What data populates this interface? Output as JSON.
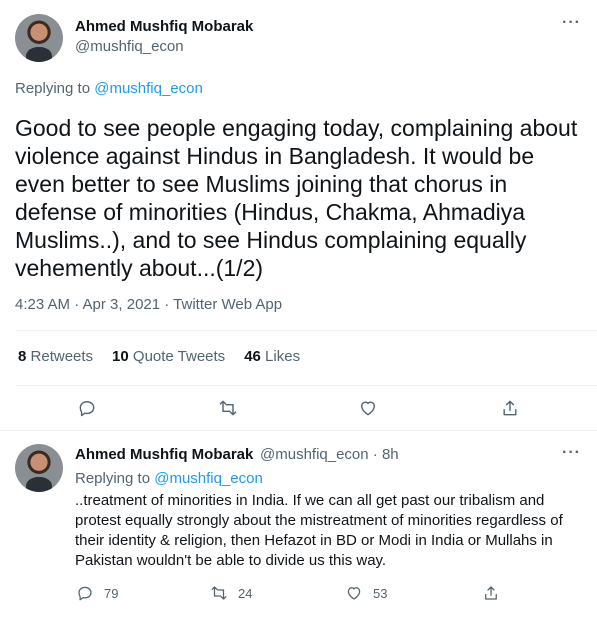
{
  "main_tweet": {
    "author_name": "Ahmed Mushfiq Mobarak",
    "author_handle": "@mushfiq_econ",
    "replying_prefix": "Replying to",
    "replying_to": "@mushfiq_econ",
    "text": "Good to see people engaging today, complaining about violence against Hindus in Bangladesh. It would be even better to see Muslims joining that chorus in defense of minorities (Hindus, Chakma, Ahmadiya Muslims..), and to see Hindus complaining equally vehemently about...(1/2)",
    "timestamp": "4:23 AM · Apr 3, 2021 · Twitter Web App",
    "stats": {
      "retweets_count": "8",
      "retweets_label": "Retweets",
      "quotes_count": "10",
      "quotes_label": "Quote Tweets",
      "likes_count": "46",
      "likes_label": "Likes"
    },
    "more_icon": "more-horizontal-icon"
  },
  "reply_tweet": {
    "author_name": "Ahmed Mushfiq Mobarak",
    "author_handle_time": "@mushfiq_econ · 8h",
    "replying_prefix": "Replying to",
    "replying_to": "@mushfiq_econ",
    "text": "..treatment of minorities in India. If we can all get past our tribalism and protest equally strongly about the mistreatment of minorities regardless of their identity & religion, then Hefazot in BD or Modi in India or Mullahs in Pakistan wouldn't be able to divide us this way.",
    "reply_count": "79",
    "retweet_count": "24",
    "like_count": "53"
  },
  "colors": {
    "accent": "#1d9bf0",
    "secondary_text": "#536471",
    "primary_text": "#0f1419",
    "divider": "#eff3f4"
  }
}
